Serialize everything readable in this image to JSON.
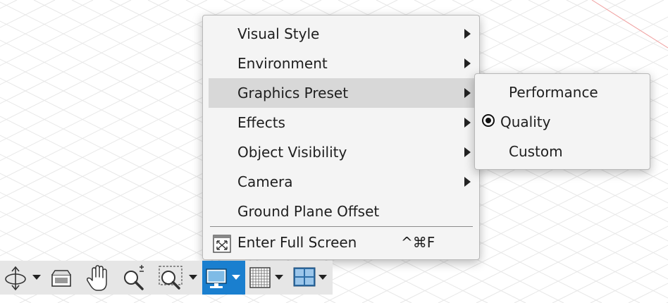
{
  "main_menu": {
    "items": [
      {
        "label": "Visual Style"
      },
      {
        "label": "Environment"
      },
      {
        "label": "Graphics Preset"
      },
      {
        "label": "Effects"
      },
      {
        "label": "Object Visibility"
      },
      {
        "label": "Camera"
      },
      {
        "label": "Ground Plane Offset"
      }
    ],
    "full_screen": {
      "label": "Enter Full Screen",
      "shortcut": "^⌘F",
      "icon": "fullscreen-icon"
    }
  },
  "submenu": {
    "items": [
      {
        "label": "Performance",
        "checked": false
      },
      {
        "label": "Quality",
        "checked": true
      },
      {
        "label": "Custom",
        "checked": false
      }
    ]
  },
  "toolbar": {
    "tools": [
      {
        "icon": "orbit-icon",
        "has_dropdown": true
      },
      {
        "icon": "look-at-icon",
        "has_dropdown": false
      },
      {
        "icon": "pan-hand-icon",
        "has_dropdown": false
      },
      {
        "icon": "zoom-icon",
        "has_dropdown": false
      },
      {
        "icon": "zoom-window-icon",
        "has_dropdown": true
      },
      {
        "icon": "display-settings-icon",
        "has_dropdown": true,
        "active": true
      },
      {
        "icon": "grid-snaps-icon",
        "has_dropdown": true
      },
      {
        "icon": "viewports-icon",
        "has_dropdown": true
      }
    ]
  },
  "colors": {
    "active_tool_bg": "#1a7fcf",
    "menu_highlight": "#d8d8d8",
    "toolbar_bg": "#e6e6e6"
  }
}
